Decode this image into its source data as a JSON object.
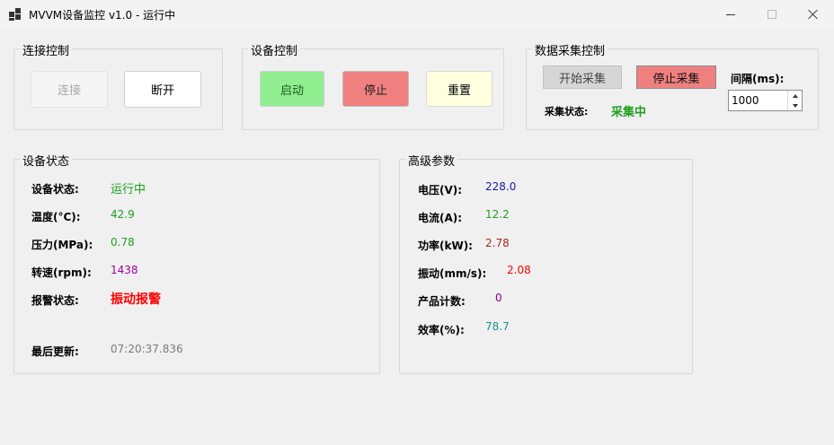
{
  "window": {
    "title": "MVVM设备监控 v1.0 - 运行中",
    "icon": "app-grid-icon",
    "controls": [
      "minimize-icon",
      "maximize-icon",
      "close-icon"
    ]
  },
  "connection": {
    "group_title": "连接控制",
    "connect_label": "连接",
    "disconnect_label": "断开"
  },
  "device_control": {
    "group_title": "设备控制",
    "start_label": "启动",
    "stop_label": "停止",
    "reset_label": "重置"
  },
  "acquisition": {
    "group_title": "数据采集控制",
    "start_label": "开始采集",
    "stop_label": "停止采集",
    "interval_label": "间隔(ms):",
    "interval_value": "1000",
    "status_label": "采集状态:",
    "status_value": "采集中"
  },
  "device_status": {
    "group_title": "设备状态",
    "rows": [
      {
        "label": "设备状态:",
        "value": "运行中"
      },
      {
        "label": "温度(°C):",
        "value": "42.9"
      },
      {
        "label": "压力(MPa):",
        "value": "0.78"
      },
      {
        "label": "转速(rpm):",
        "value": "1438"
      },
      {
        "label": "报警状态:",
        "value": "振动报警"
      },
      {
        "label": "最后更新:",
        "value": "07:20:37.836"
      }
    ]
  },
  "advanced": {
    "group_title": "高级参数",
    "rows": [
      {
        "label": "电压(V):",
        "value": "228.0"
      },
      {
        "label": "电流(A):",
        "value": "12.2"
      },
      {
        "label": "功率(kW):",
        "value": "2.78"
      },
      {
        "label": "振动(mm/s):",
        "value": "2.08"
      },
      {
        "label": "产品计数:",
        "value": "0"
      },
      {
        "label": "效率(%):",
        "value": "78.7"
      }
    ]
  },
  "colors": {
    "start_button": "#90ee90",
    "stop_button": "#f08080",
    "reset_button": "#ffffe0",
    "running": "#1e9e1e",
    "alarm": "#ff0000",
    "voltage": "#1a1aa0",
    "rpm": "#a000a0"
  }
}
